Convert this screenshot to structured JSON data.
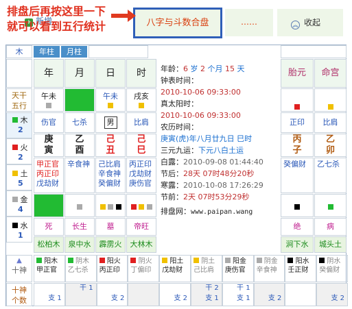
{
  "annotation": {
    "line1": "排盘后再按这里一下",
    "line2": "就可以看到五行统计"
  },
  "toolbar": {
    "add_label": "新增",
    "main_button": "八字与斗数合盘",
    "dots": "……",
    "collapse": "收起"
  },
  "headers": {
    "wood": "木",
    "year": "年柱",
    "month": "月柱"
  },
  "pillars": {
    "labels": [
      "年",
      "月",
      "日",
      "时"
    ],
    "taiyuan": "胎元",
    "minggong": "命宫"
  },
  "tiangan_label": [
    "天干",
    "五行"
  ],
  "row_gz": [
    "午未",
    "",
    "午未",
    "戌亥"
  ],
  "shishen": [
    "伤官",
    "七杀",
    "男",
    "比肩",
    "正印",
    "比肩"
  ],
  "gan": [
    "庚",
    "乙",
    "己",
    "己",
    "丙",
    "乙"
  ],
  "zhi": [
    "寅",
    "酉",
    "丑",
    "巳",
    "子",
    "卯"
  ],
  "canggan": [
    [
      "甲正官",
      "丙正印",
      "戊劫财"
    ],
    [
      "辛食神"
    ],
    [
      "己比肩",
      "辛食神",
      "癸偏财"
    ],
    [
      "丙正印",
      "戊劫财",
      "庚伤官"
    ],
    [
      "癸偏财"
    ],
    [
      "乙七杀"
    ]
  ],
  "xingyun": [
    "死",
    "长生",
    "墓",
    "帝旺",
    "绝",
    "病"
  ],
  "nayin": [
    "松柏木",
    "泉中水",
    "霹雳火",
    "大林木",
    "涧下水",
    "城头土"
  ],
  "wuxing_side": [
    {
      "name": "木",
      "count": "2"
    },
    {
      "name": "火",
      "count": "2"
    },
    {
      "name": "土",
      "count": "5"
    },
    {
      "name": "金",
      "count": "4"
    },
    {
      "name": "水",
      "count": "1"
    }
  ],
  "info": {
    "age_label": "年龄：",
    "age": "6",
    "age_unit1": "岁",
    "age_m": "2",
    "age_unit2": "个月",
    "age_d": "15",
    "age_unit3": "天",
    "clock_label": "钟表时间：",
    "clock": "2010-10-06 09:33:00",
    "solar_label": "真太阳时：",
    "solar": "2010-10-06 09:33:00",
    "lunar_label": "农历时间：",
    "lunar": "庚寅(虎)年八月廿九日 巳时",
    "yuan_label": "三元九运：",
    "yuan": "下元八白土运",
    "bailu_label": "白露：",
    "bailu": "2010-09-08 01:44:40",
    "jq_after_label": "节后：",
    "jq_after": "28天 07时48分20秒",
    "hanlu_label": "寒露：",
    "hanlu": "2010-10-08 17:26:29",
    "jq_before_label": "节前：",
    "jq_before": "2天 07时53分29秒",
    "site_label": "排盘网：",
    "site": "www.paipan.wang"
  },
  "bottom": {
    "tri": "十神",
    "cells": [
      [
        "阳木",
        "甲正官"
      ],
      [
        "阴木",
        "乙七杀"
      ],
      [
        "阳火",
        "丙正印"
      ],
      [
        "阴火",
        "丁偏印"
      ],
      [
        "阳土",
        "戊劫财"
      ],
      [
        "阴土",
        "己比肩"
      ],
      [
        "阳金",
        "庚伤官"
      ],
      [
        "阴金",
        "辛食神"
      ],
      [
        "阳水",
        "壬正财"
      ],
      [
        "阴水",
        "癸偏财"
      ]
    ],
    "gods_label": [
      "十神",
      "个数"
    ],
    "counts": [
      {
        "gan": "",
        "zhi": "支 1"
      },
      {
        "gan": "干 1",
        "zhi": ""
      },
      {
        "gan": "",
        "zhi": "支 2"
      },
      {
        "gan": "",
        "zhi": ""
      },
      {
        "gan": "",
        "zhi": "支 2"
      },
      {
        "gan": "干 2",
        "zhi": "支 1"
      },
      {
        "gan": "干 1",
        "zhi": "支 1"
      },
      {
        "gan": "",
        "zhi": "支 2"
      },
      {
        "gan": "",
        "zhi": ""
      },
      {
        "gan": "",
        "zhi": "支 2"
      }
    ]
  }
}
